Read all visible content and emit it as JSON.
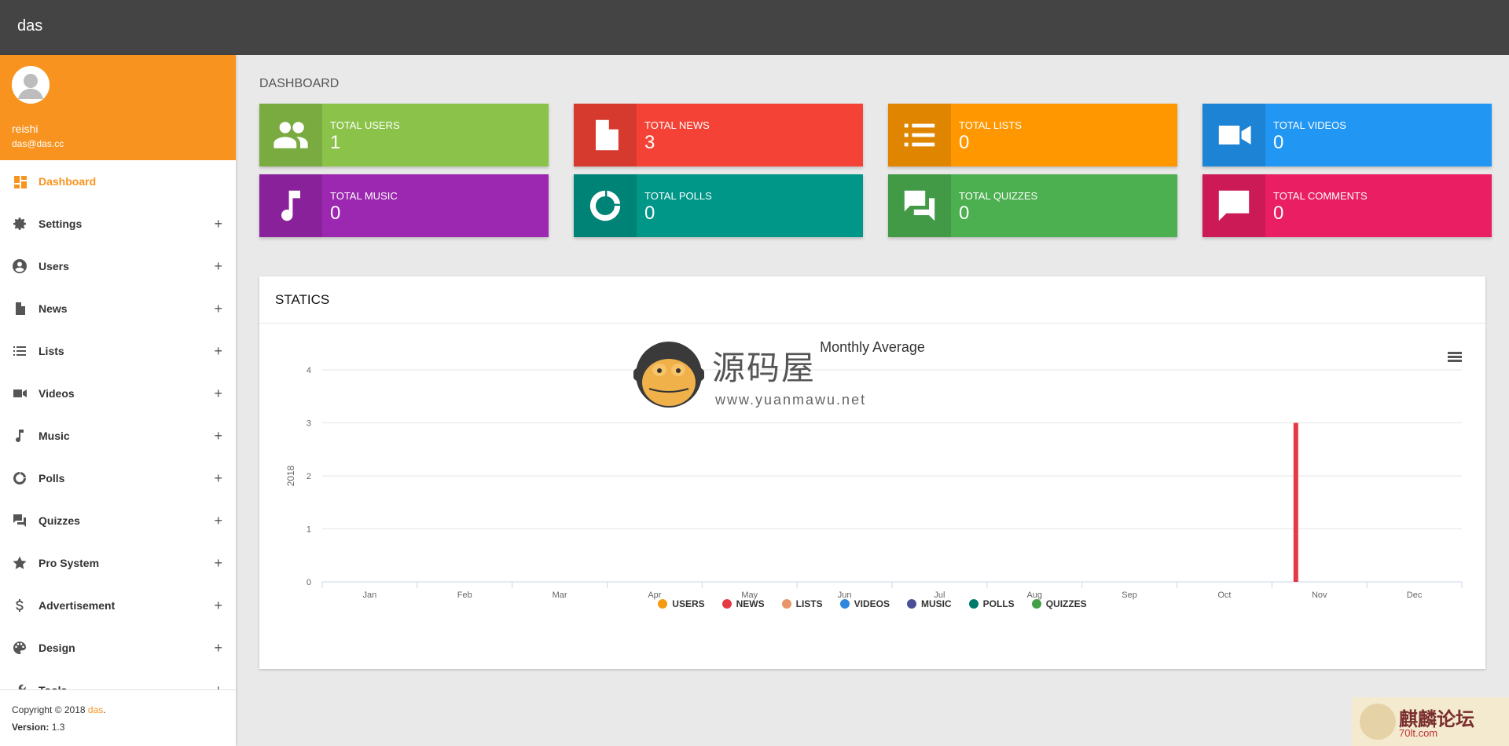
{
  "app": {
    "brand": "das"
  },
  "user": {
    "name": "reishi",
    "email": "das@das.cc"
  },
  "sidebar": {
    "items": [
      {
        "label": "Dashboard",
        "icon": "dashboard-icon",
        "active": true,
        "expandable": false
      },
      {
        "label": "Settings",
        "icon": "gear-icon",
        "expandable": true,
        "toggle": "+"
      },
      {
        "label": "Users",
        "icon": "user-circle-icon",
        "expandable": true,
        "toggle": "+"
      },
      {
        "label": "News",
        "icon": "file-icon",
        "expandable": true,
        "toggle": "+"
      },
      {
        "label": "Lists",
        "icon": "list-icon",
        "expandable": true,
        "toggle": "+"
      },
      {
        "label": "Videos",
        "icon": "video-camera-icon",
        "expandable": true,
        "toggle": "+"
      },
      {
        "label": "Music",
        "icon": "music-note-icon",
        "expandable": true,
        "toggle": "+"
      },
      {
        "label": "Polls",
        "icon": "donut-icon",
        "expandable": true,
        "toggle": "+"
      },
      {
        "label": "Quizzes",
        "icon": "chat-bubbles-icon",
        "expandable": true,
        "toggle": "+"
      },
      {
        "label": "Pro System",
        "icon": "star-icon",
        "expandable": true,
        "toggle": "+"
      },
      {
        "label": "Advertisement",
        "icon": "dollar-icon",
        "expandable": true,
        "toggle": "+"
      },
      {
        "label": "Design",
        "icon": "palette-icon",
        "expandable": true,
        "toggle": "+"
      },
      {
        "label": "Tools",
        "icon": "wrench-icon",
        "expandable": true,
        "toggle": "+"
      }
    ],
    "footer": {
      "copyright_prefix": "Copyright © 2018 ",
      "copyright_brand": "das",
      "copyright_suffix": ".",
      "version_label": "Version:",
      "version_value": " 1.3"
    }
  },
  "dashboard": {
    "title": "DASHBOARD",
    "cards": [
      {
        "label": "TOTAL USERS",
        "value": "1",
        "color": "#8bc34a",
        "icon": "users-icon"
      },
      {
        "label": "TOTAL NEWS",
        "value": "3",
        "color": "#f44336",
        "icon": "file-icon"
      },
      {
        "label": "TOTAL LISTS",
        "value": "0",
        "color": "#ff9800",
        "icon": "list-icon"
      },
      {
        "label": "TOTAL VIDEOS",
        "value": "0",
        "color": "#2196f3",
        "icon": "video-camera-icon"
      },
      {
        "label": "TOTAL MUSIC",
        "value": "0",
        "color": "#9c27b0",
        "icon": "music-note-icon"
      },
      {
        "label": "TOTAL POLLS",
        "value": "0",
        "color": "#009688",
        "icon": "donut-icon"
      },
      {
        "label": "TOTAL QUIZZES",
        "value": "0",
        "color": "#4caf50",
        "icon": "chat-bubbles-icon"
      },
      {
        "label": "TOTAL COMMENTS",
        "value": "0",
        "color": "#e91e63",
        "icon": "comment-icon"
      }
    ],
    "panel_title": "STATICS"
  },
  "watermark": {
    "cn": "源码屋",
    "url": "www.yuanmawu.net",
    "corner_text": "麒麟论坛",
    "corner_url": "70lt.com"
  },
  "chart_data": {
    "type": "bar",
    "title": "Monthly Average",
    "ylabel": "2018",
    "ylim": [
      0,
      4
    ],
    "yticks": [
      "0",
      "1",
      "2",
      "3",
      "4"
    ],
    "categories": [
      "Jan",
      "Feb",
      "Mar",
      "Apr",
      "May",
      "Jun",
      "Jul",
      "Aug",
      "Sep",
      "Oct",
      "Nov",
      "Dec"
    ],
    "legend_position": "bottom",
    "grid": true,
    "series": [
      {
        "name": "USERS",
        "color": "#f39c12",
        "values": [
          0,
          0,
          0,
          0,
          0,
          0,
          0,
          0,
          0,
          0,
          0,
          0
        ]
      },
      {
        "name": "NEWS",
        "color": "#e63946",
        "values": [
          0,
          0,
          0,
          0,
          0,
          0,
          0,
          0,
          0,
          0,
          3,
          0
        ]
      },
      {
        "name": "LISTS",
        "color": "#e8956a",
        "values": [
          0,
          0,
          0,
          0,
          0,
          0,
          0,
          0,
          0,
          0,
          0,
          0
        ]
      },
      {
        "name": "VIDEOS",
        "color": "#2e86de",
        "values": [
          0,
          0,
          0,
          0,
          0,
          0,
          0,
          0,
          0,
          0,
          0,
          0
        ]
      },
      {
        "name": "MUSIC",
        "color": "#4a5096",
        "values": [
          0,
          0,
          0,
          0,
          0,
          0,
          0,
          0,
          0,
          0,
          0,
          0
        ]
      },
      {
        "name": "POLLS",
        "color": "#00796b",
        "values": [
          0,
          0,
          0,
          0,
          0,
          0,
          0,
          0,
          0,
          0,
          0,
          0
        ]
      },
      {
        "name": "QUIZZES",
        "color": "#43a047",
        "values": [
          0,
          0,
          0,
          0,
          0,
          0,
          0,
          0,
          0,
          0,
          0,
          0
        ]
      }
    ]
  }
}
